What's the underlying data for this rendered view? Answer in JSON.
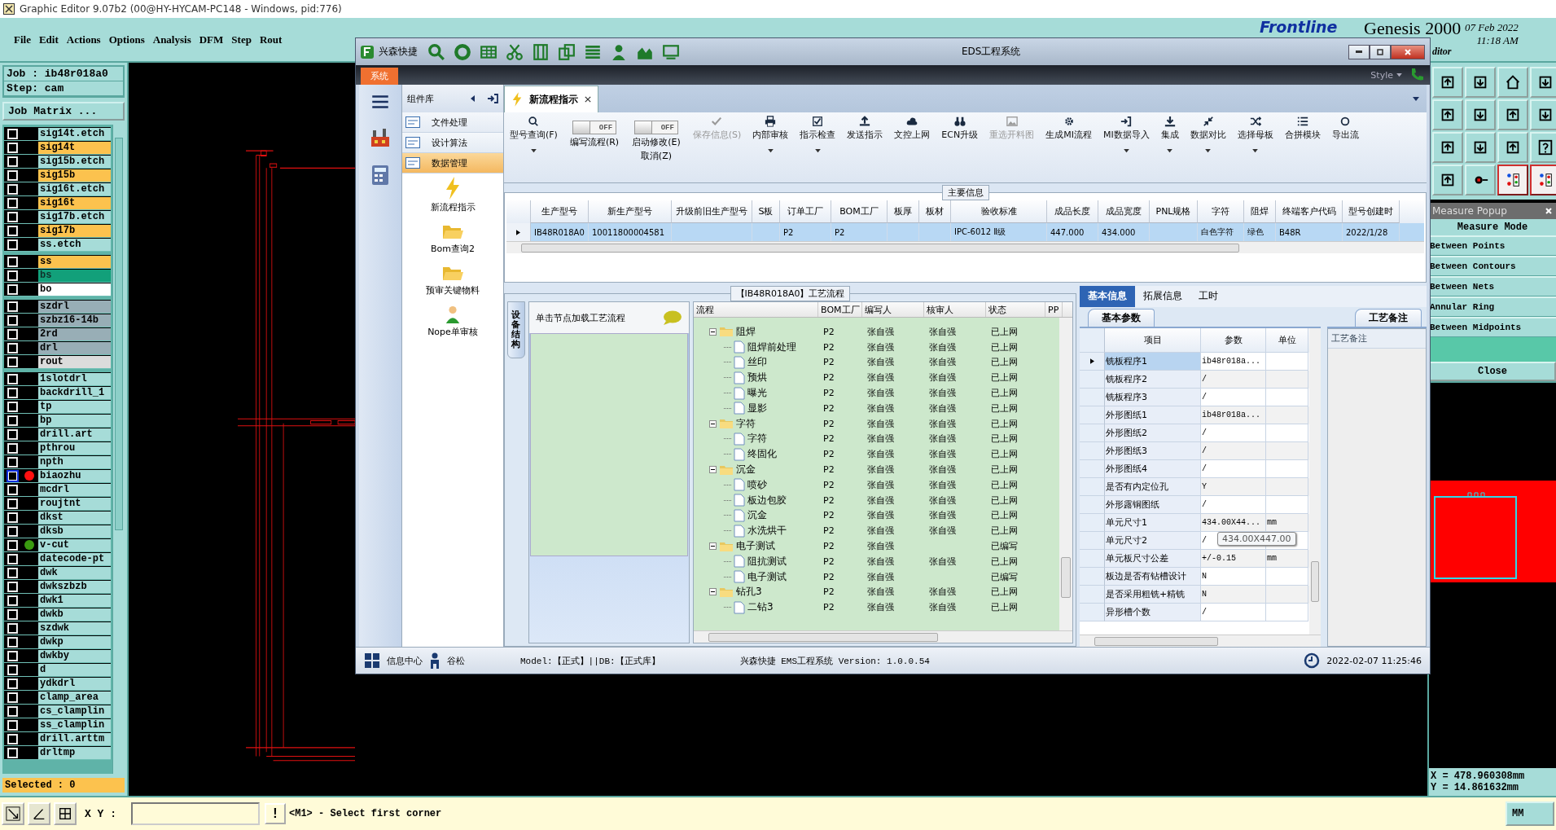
{
  "window": {
    "title": "Graphic Editor 9.07b2 (00@HY-HYCAM-PC148 - Windows, pid:776)"
  },
  "menu": [
    "File",
    "Edit",
    "Actions",
    "Options",
    "Analysis",
    "DFM",
    "Step",
    "Rout"
  ],
  "brand": {
    "logo": "Frontline",
    "product": "Genesis 2000",
    "date": "07 Feb 2022",
    "time": "11:18 AM",
    "subtitle": "ditor"
  },
  "job": {
    "job": "Job : ib48r018a0",
    "step": "Step: cam",
    "matrix_button": "Job Matrix ..."
  },
  "layer_groups": [
    [
      {
        "name": "sig14t.etch",
        "color": "#a6dcd8",
        "selected": false
      },
      {
        "name": "sig14t",
        "color": "#fcc24e",
        "selected": false
      },
      {
        "name": "sig15b.etch",
        "color": "#a6dcd8",
        "selected": false
      },
      {
        "name": "sig15b",
        "color": "#fcc24e",
        "selected": false
      },
      {
        "name": "sig16t.etch",
        "color": "#a6dcd8",
        "selected": false
      },
      {
        "name": "sig16t",
        "color": "#fcc24e",
        "selected": false
      },
      {
        "name": "sig17b.etch",
        "color": "#a6dcd8",
        "selected": false
      },
      {
        "name": "sig17b",
        "color": "#fcc24e",
        "selected": false
      },
      {
        "name": "ss.etch",
        "color": "#a6dcd8",
        "selected": false
      }
    ],
    [
      {
        "name": "ss",
        "color": "#fcc24e",
        "selected": false
      },
      {
        "name": "bs",
        "color": "#12a07a",
        "selected": false
      },
      {
        "name": "bo",
        "color": "#ffffff",
        "selected": false
      }
    ],
    [
      {
        "name": "szdrl",
        "color": "#98aeb6",
        "selected": false
      },
      {
        "name": "szbz16-14b",
        "color": "#98aeb6",
        "selected": false
      },
      {
        "name": "2rd",
        "color": "#98aeb6",
        "selected": false
      },
      {
        "name": "drl",
        "color": "#98aeb6",
        "selected": false
      },
      {
        "name": "rout",
        "color": "#dcdcdc",
        "selected": false
      }
    ],
    [
      {
        "name": "1slotdrl",
        "color": "#a6dcd8",
        "selected": false
      },
      {
        "name": "backdrill_1",
        "color": "#a6dcd8",
        "selected": false
      },
      {
        "name": "tp",
        "color": "#a6dcd8",
        "selected": false
      },
      {
        "name": "bp",
        "color": "#a6dcd8",
        "selected": false
      },
      {
        "name": "drill.art",
        "color": "#a6dcd8",
        "selected": false
      },
      {
        "name": "pthrou",
        "color": "#a6dcd8",
        "selected": false
      },
      {
        "name": "npth",
        "color": "#a6dcd8",
        "selected": false
      },
      {
        "name": "biaozhu",
        "color": "#a6dcd8",
        "selected": true,
        "marker": {
          "color": "#ff1010"
        }
      },
      {
        "name": "mcdrl",
        "color": "#a6dcd8",
        "selected": false
      },
      {
        "name": "roujtnt",
        "color": "#a6dcd8",
        "selected": false
      },
      {
        "name": "dkst",
        "color": "#a6dcd8",
        "selected": false
      },
      {
        "name": "dksb",
        "color": "#a6dcd8",
        "selected": false
      },
      {
        "name": "v-cut",
        "color": "#a6dcd8",
        "selected": false,
        "marker": {
          "color": "#3a9a10"
        }
      },
      {
        "name": "datecode-pt",
        "color": "#a6dcd8",
        "selected": false
      },
      {
        "name": "dwk",
        "color": "#a6dcd8",
        "selected": false
      },
      {
        "name": "dwkszbzb",
        "color": "#a6dcd8",
        "selected": false
      },
      {
        "name": "dwk1",
        "color": "#a6dcd8",
        "selected": false
      },
      {
        "name": "dwkb",
        "color": "#a6dcd8",
        "selected": false
      },
      {
        "name": "szdwk",
        "color": "#a6dcd8",
        "selected": false
      },
      {
        "name": "dwkp",
        "color": "#a6dcd8",
        "selected": false
      },
      {
        "name": "dwkby",
        "color": "#a6dcd8",
        "selected": false
      },
      {
        "name": "d",
        "color": "#a6dcd8",
        "selected": false
      },
      {
        "name": "ydkdrl",
        "color": "#a6dcd8",
        "selected": false
      },
      {
        "name": "clamp_area",
        "color": "#a6dcd8",
        "selected": false
      },
      {
        "name": "cs_clamplin",
        "color": "#a6dcd8",
        "selected": false
      },
      {
        "name": "ss_clamplin",
        "color": "#a6dcd8",
        "selected": false
      },
      {
        "name": "drill.arttm",
        "color": "#a6dcd8",
        "selected": false
      },
      {
        "name": "drltmp",
        "color": "#a6dcd8",
        "selected": false
      }
    ]
  ],
  "selected_count": "Selected : 0",
  "command_bar": {
    "label": "X Y :",
    "alert_button": "!",
    "prompt": "<M1> - Select first corner",
    "units": "MM"
  },
  "measure_popup": {
    "title": "Measure Popup",
    "heading": "Measure Mode",
    "modes": [
      "Between Points",
      "Between Contours",
      "Between Nets",
      "Annular Ring",
      "Between Midpoints"
    ],
    "close": "Close"
  },
  "coordinates": [
    "X = 478.960308mm",
    "Y = 14.861632mm"
  ],
  "eds": {
    "app_name": "兴森快捷",
    "title": "EDS工程系统",
    "system_tab": "系统",
    "style_label": "Style",
    "side_panel": {
      "title": "组件库",
      "categories": [
        {
          "label": "文件处理",
          "selected": false
        },
        {
          "label": "设计算法",
          "selected": false
        },
        {
          "label": "数据管理",
          "selected": true
        }
      ],
      "modules": [
        {
          "label": "新流程指示",
          "kind": "lightning"
        },
        {
          "label": "Bom查询2",
          "kind": "folder"
        },
        {
          "label": "预审关键物料",
          "kind": "folder"
        },
        {
          "label": "Nope单审核",
          "kind": "person"
        }
      ]
    },
    "doc_tabs": [
      {
        "label": "新流程指示",
        "selected": true
      }
    ],
    "ribbon": [
      {
        "kind": "button",
        "label": "型号查询(F)",
        "dropdown": true,
        "disabled": false
      },
      {
        "kind": "switch",
        "label": "编写流程(R)",
        "switch": "OFF",
        "on": false
      },
      {
        "kind": "switch",
        "label": "启动修改(E)",
        "sublabel": "取消(Z)",
        "switch": "OFF",
        "on": false
      },
      {
        "kind": "button",
        "label": "保存信息(S)",
        "dropdown": false,
        "disabled": true
      },
      {
        "kind": "button",
        "label": "内部审核",
        "dropdown": true,
        "disabled": false
      },
      {
        "kind": "button",
        "label": "指示检查",
        "dropdown": true,
        "disabled": false
      },
      {
        "kind": "button",
        "label": "发送指示",
        "dropdown": false,
        "disabled": false
      },
      {
        "kind": "button",
        "label": "文控上网",
        "dropdown": false,
        "disabled": false
      },
      {
        "kind": "button",
        "label": "ECN升级",
        "dropdown": false,
        "disabled": false
      },
      {
        "kind": "button",
        "label": "重选开料图",
        "dropdown": false,
        "disabled": true
      },
      {
        "kind": "button",
        "label": "生成MI流程",
        "dropdown": false,
        "disabled": false
      },
      {
        "kind": "button",
        "label": "MI数据导入",
        "dropdown": true,
        "disabled": false
      },
      {
        "kind": "button",
        "label": "集成",
        "dropdown": true,
        "disabled": false
      },
      {
        "kind": "button",
        "label": "数据对比",
        "dropdown": true,
        "disabled": false
      },
      {
        "kind": "button",
        "label": "选择母板",
        "dropdown": true,
        "disabled": false
      },
      {
        "kind": "button",
        "label": "合拼模块",
        "dropdown": false,
        "disabled": false
      },
      {
        "kind": "button",
        "label": "导出流",
        "dropdown": false,
        "disabled": false
      }
    ],
    "main_info": {
      "title": "主要信息",
      "columns": [
        "生产型号",
        "新生产型号",
        "升级前旧生产型号",
        "S板",
        "订单工厂",
        "BOM工厂",
        "板厚",
        "板材",
        "验收标准",
        "成品长度",
        "成品宽度",
        "PNL规格",
        "字符",
        "阻焊",
        "终端客户代码",
        "型号创建时"
      ],
      "rows": [
        {
          "selected": true,
          "cells": [
            "IB48R018A0",
            "10011800004581",
            null,
            null,
            "P2",
            "P2",
            null,
            null,
            "IPC-6012 Ⅱ级",
            "447.000",
            "434.000",
            null,
            "白色字符",
            "绿色",
            "B48R",
            "2022/1/28"
          ]
        }
      ]
    },
    "process": {
      "title": "【IB48R018A0】工艺流程",
      "side_tab": "设备结构",
      "hint": "单击节点加载工艺流程",
      "columns": [
        "流程",
        "BOM工厂",
        "编写人",
        "核审人",
        "状态",
        "PP"
      ],
      "tree": [
        {
          "label": "阻焊",
          "bom": "P2",
          "writer": "张自强",
          "reviewer": "张自强",
          "status": "已上网",
          "expanded": true,
          "children": [
            {
              "label": "阻焊前处理",
              "bom": "P2",
              "writer": "张自强",
              "reviewer": "张自强",
              "status": "已上网"
            },
            {
              "label": "丝印",
              "bom": "P2",
              "writer": "张自强",
              "reviewer": "张自强",
              "status": "已上网"
            },
            {
              "label": "预烘",
              "bom": "P2",
              "writer": "张自强",
              "reviewer": "张自强",
              "status": "已上网"
            },
            {
              "label": "曝光",
              "bom": "P2",
              "writer": "张自强",
              "reviewer": "张自强",
              "status": "已上网"
            },
            {
              "label": "显影",
              "bom": "P2",
              "writer": "张自强",
              "reviewer": "张自强",
              "status": "已上网"
            }
          ]
        },
        {
          "label": "字符",
          "bom": "P2",
          "writer": "张自强",
          "reviewer": "张自强",
          "status": "已上网",
          "expanded": true,
          "children": [
            {
              "label": "字符",
              "bom": "P2",
              "writer": "张自强",
              "reviewer": "张自强",
              "status": "已上网"
            },
            {
              "label": "终固化",
              "bom": "P2",
              "writer": "张自强",
              "reviewer": "张自强",
              "status": "已上网"
            }
          ]
        },
        {
          "label": "沉金",
          "bom": "P2",
          "writer": "张自强",
          "reviewer": "张自强",
          "status": "已上网",
          "expanded": true,
          "children": [
            {
              "label": "喷砂",
              "bom": "P2",
              "writer": "张自强",
              "reviewer": "张自强",
              "status": "已上网"
            },
            {
              "label": "板边包胶",
              "bom": "P2",
              "writer": "张自强",
              "reviewer": "张自强",
              "status": "已上网"
            },
            {
              "label": "沉金",
              "bom": "P2",
              "writer": "张自强",
              "reviewer": "张自强",
              "status": "已上网"
            },
            {
              "label": "水洗烘干",
              "bom": "P2",
              "writer": "张自强",
              "reviewer": "张自强",
              "status": "已上网"
            }
          ]
        },
        {
          "label": "电子测试",
          "bom": "P2",
          "writer": "张自强",
          "status": "已编写",
          "expanded": true,
          "children": [
            {
              "label": "阻抗测试",
              "bom": "P2",
              "writer": "张自强",
              "reviewer": "张自强",
              "status": "已上网"
            },
            {
              "label": "电子测试",
              "bom": "P2",
              "writer": "张自强",
              "status": "已编写"
            }
          ]
        },
        {
          "label": "钻孔3",
          "bom": "P2",
          "writer": "张自强",
          "reviewer": "张自强",
          "status": "已上网",
          "expanded": true,
          "children": [
            {
              "label": "二钻3",
              "bom": "P2",
              "writer": "张自强",
              "reviewer": "张自强",
              "status": "已上网"
            }
          ]
        }
      ]
    },
    "details": {
      "tabs": [
        {
          "label": "基本信息",
          "selected": true
        },
        {
          "label": "拓展信息",
          "selected": false
        },
        {
          "label": "工时",
          "selected": false
        }
      ],
      "subtab": "基本参数",
      "columns": [
        "项目",
        "参数",
        "单位"
      ],
      "rows": [
        {
          "item": "铣板程序1",
          "value": "ib48r018a...",
          "selected": true
        },
        {
          "item": "铣板程序2",
          "value": "/",
          "selected": false
        },
        {
          "item": "铣板程序3",
          "value": "/",
          "selected": false
        },
        {
          "item": "外形图纸1",
          "value": "ib48r018a...",
          "selected": false
        },
        {
          "item": "外形图纸2",
          "value": "/",
          "selected": false
        },
        {
          "item": "外形图纸3",
          "value": "/",
          "selected": false
        },
        {
          "item": "外形图纸4",
          "value": "/",
          "selected": false
        },
        {
          "item": "是否有内定位孔",
          "value": "Y",
          "selected": false
        },
        {
          "item": "外形露铜图纸",
          "value": "/",
          "selected": false
        },
        {
          "item": "单元尺寸1",
          "value": "434.00X44...",
          "unit": "mm",
          "selected": false
        },
        {
          "item": "单元尺寸2",
          "value": "/",
          "selected": false
        },
        {
          "item": "单元板尺寸公差",
          "value": "+/-0.15",
          "unit": "mm",
          "selected": false
        },
        {
          "item": "板边是否有钻槽设计",
          "value": "N",
          "selected": false
        },
        {
          "item": "是否采用粗铣+精铣",
          "value": "N",
          "selected": false
        },
        {
          "item": "异形槽个数",
          "value": "/",
          "selected": false
        }
      ],
      "tooltip": "434.00X447.00",
      "notes": {
        "title": "工艺备注",
        "label": "工艺备注"
      }
    },
    "status_bar": {
      "info_center": "信息中心",
      "user": "谷松",
      "model": "Model:【正式】||DB:【正式库】",
      "version": "兴森快捷 EMS工程系统 Version: 1.0.0.54",
      "datetime": "2022-02-07 11:25:46"
    }
  }
}
